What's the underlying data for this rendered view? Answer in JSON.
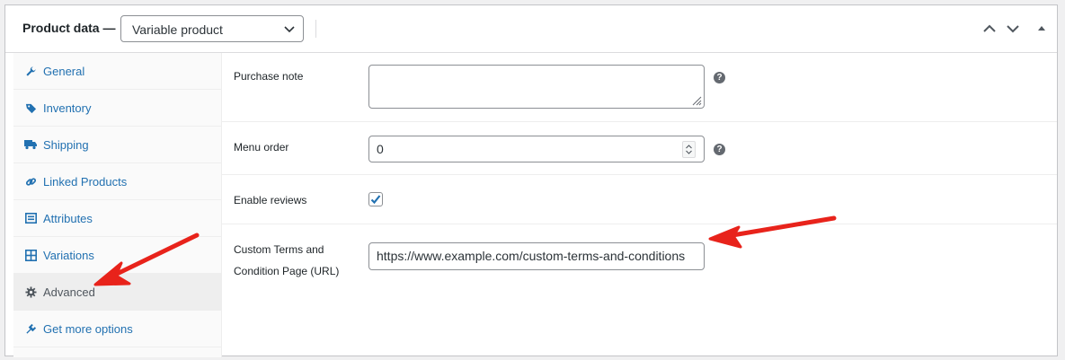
{
  "header": {
    "title": "Product data —",
    "product_type": "Variable product"
  },
  "sidebar": {
    "items": [
      {
        "label": "General",
        "icon": "wrench-icon"
      },
      {
        "label": "Inventory",
        "icon": "tag-icon"
      },
      {
        "label": "Shipping",
        "icon": "truck-icon"
      },
      {
        "label": "Linked Products",
        "icon": "link-icon"
      },
      {
        "label": "Attributes",
        "icon": "list-icon"
      },
      {
        "label": "Variations",
        "icon": "grid-icon"
      },
      {
        "label": "Advanced",
        "icon": "gear-icon",
        "active": true
      },
      {
        "label": "Get more options",
        "icon": "plugin-icon"
      }
    ]
  },
  "fields": {
    "purchase_note": {
      "label": "Purchase note",
      "value": ""
    },
    "menu_order": {
      "label": "Menu order",
      "value": "0"
    },
    "enable_reviews": {
      "label": "Enable reviews",
      "checked": true
    },
    "custom_terms": {
      "label_line1": "Custom Terms and",
      "label_line2": "Condition Page (URL)",
      "value": "https://www.example.com/custom-terms-and-conditions"
    }
  },
  "help_glyph": "?",
  "colors": {
    "link": "#2271b1",
    "arrow": "#e8231b",
    "active_tab_bg": "#eeeeee"
  }
}
